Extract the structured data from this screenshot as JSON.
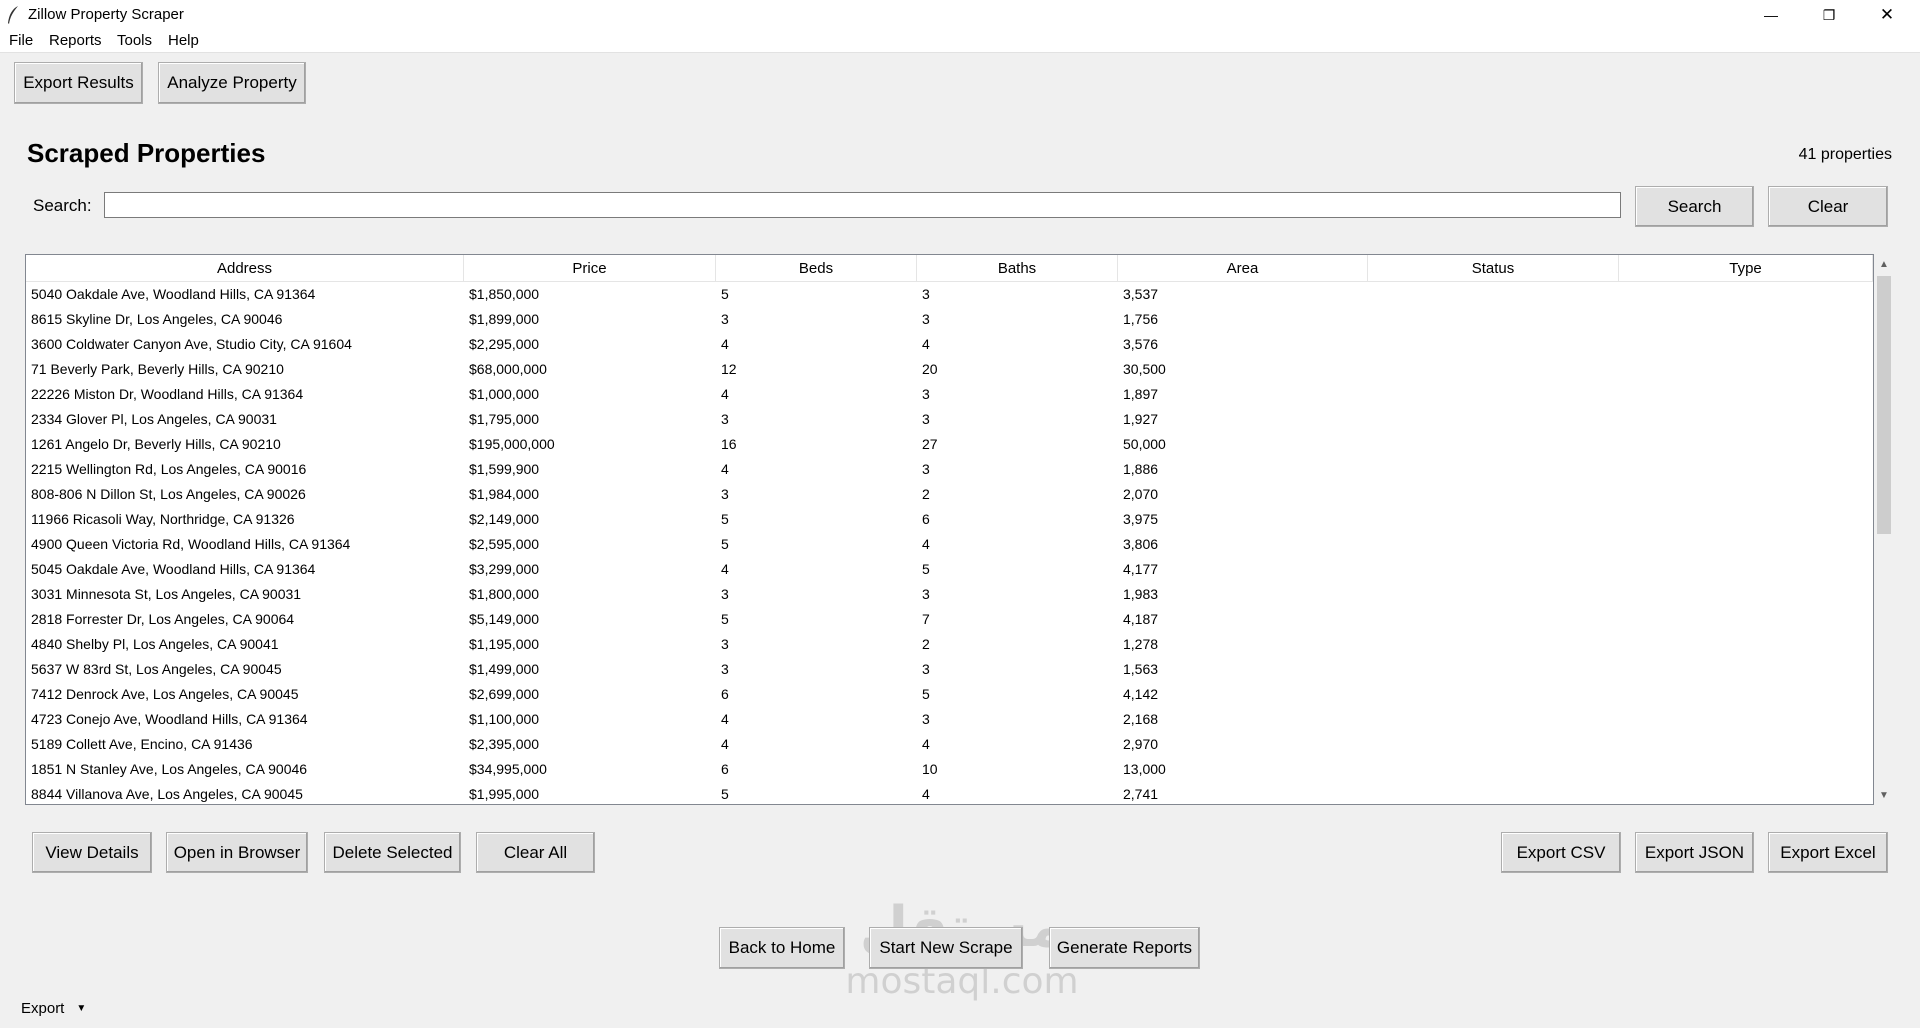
{
  "window": {
    "title": "Zillow Property Scraper",
    "controls": [
      "—",
      "❐",
      "✕"
    ]
  },
  "menu": [
    "File",
    "Reports",
    "Tools",
    "Help"
  ],
  "toolbar": {
    "export_results": "Export Results",
    "analyze_property": "Analyze Property"
  },
  "main": {
    "heading": "Scraped Properties",
    "count": "41 properties",
    "search_label": "Search:",
    "search_value": "",
    "search_button": "Search",
    "clear_button": "Clear"
  },
  "table": {
    "columns": [
      "Address",
      "Price",
      "Beds",
      "Baths",
      "Area",
      "Status",
      "Type"
    ],
    "rows": [
      [
        "5040 Oakdale Ave, Woodland Hills, CA 91364",
        "$1,850,000",
        "5",
        "3",
        "3,537",
        "",
        ""
      ],
      [
        "8615 Skyline Dr, Los Angeles, CA 90046",
        "$1,899,000",
        "3",
        "3",
        "1,756",
        "",
        ""
      ],
      [
        "3600 Coldwater Canyon Ave, Studio City, CA 91604",
        "$2,295,000",
        "4",
        "4",
        "3,576",
        "",
        ""
      ],
      [
        "71 Beverly Park, Beverly Hills, CA 90210",
        "$68,000,000",
        "12",
        "20",
        "30,500",
        "",
        ""
      ],
      [
        "22226 Miston Dr, Woodland Hills, CA 91364",
        "$1,000,000",
        "4",
        "3",
        "1,897",
        "",
        ""
      ],
      [
        "2334 Glover Pl, Los Angeles, CA 90031",
        "$1,795,000",
        "3",
        "3",
        "1,927",
        "",
        ""
      ],
      [
        "1261 Angelo Dr, Beverly Hills, CA 90210",
        "$195,000,000",
        "16",
        "27",
        "50,000",
        "",
        ""
      ],
      [
        "2215 Wellington Rd, Los Angeles, CA 90016",
        "$1,599,900",
        "4",
        "3",
        "1,886",
        "",
        ""
      ],
      [
        "808-806 N Dillon St, Los Angeles, CA 90026",
        "$1,984,000",
        "3",
        "2",
        "2,070",
        "",
        ""
      ],
      [
        "11966 Ricasoli Way, Northridge, CA 91326",
        "$2,149,000",
        "5",
        "6",
        "3,975",
        "",
        ""
      ],
      [
        "4900 Queen Victoria Rd, Woodland Hills, CA 91364",
        "$2,595,000",
        "5",
        "4",
        "3,806",
        "",
        ""
      ],
      [
        "5045 Oakdale Ave, Woodland Hills, CA 91364",
        "$3,299,000",
        "4",
        "5",
        "4,177",
        "",
        ""
      ],
      [
        "3031 Minnesota St, Los Angeles, CA 90031",
        "$1,800,000",
        "3",
        "3",
        "1,983",
        "",
        ""
      ],
      [
        "2818 Forrester Dr, Los Angeles, CA 90064",
        "$5,149,000",
        "5",
        "7",
        "4,187",
        "",
        ""
      ],
      [
        "4840 Shelby Pl, Los Angeles, CA 90041",
        "$1,195,000",
        "3",
        "2",
        "1,278",
        "",
        ""
      ],
      [
        "5637 W 83rd St, Los Angeles, CA 90045",
        "$1,499,000",
        "3",
        "3",
        "1,563",
        "",
        ""
      ],
      [
        "7412 Denrock Ave, Los Angeles, CA 90045",
        "$2,699,000",
        "6",
        "5",
        "4,142",
        "",
        ""
      ],
      [
        "4723 Conejo Ave, Woodland Hills, CA 91364",
        "$1,100,000",
        "4",
        "3",
        "2,168",
        "",
        ""
      ],
      [
        "5189 Collett Ave, Encino, CA 91436",
        "$2,395,000",
        "4",
        "4",
        "2,970",
        "",
        ""
      ],
      [
        "1851 N Stanley Ave, Los Angeles, CA 90046",
        "$34,995,000",
        "6",
        "10",
        "13,000",
        "",
        ""
      ],
      [
        "8844 Villanova Ave, Los Angeles, CA 90045",
        "$1,995,000",
        "5",
        "4",
        "2,741",
        "",
        ""
      ]
    ]
  },
  "actions": {
    "view_details": "View Details",
    "open_in_browser": "Open in Browser",
    "delete_selected": "Delete Selected",
    "clear_all": "Clear All",
    "export_csv": "Export CSV",
    "export_json": "Export JSON",
    "export_excel": "Export Excel"
  },
  "nav": {
    "back_to_home": "Back to Home",
    "start_new_scrape": "Start New Scrape",
    "generate_reports": "Generate Reports"
  },
  "watermark": {
    "arabic": "مستقل",
    "domain": "mostaql.com"
  },
  "export_dropdown": {
    "label": "Export",
    "arrow": "▼"
  }
}
